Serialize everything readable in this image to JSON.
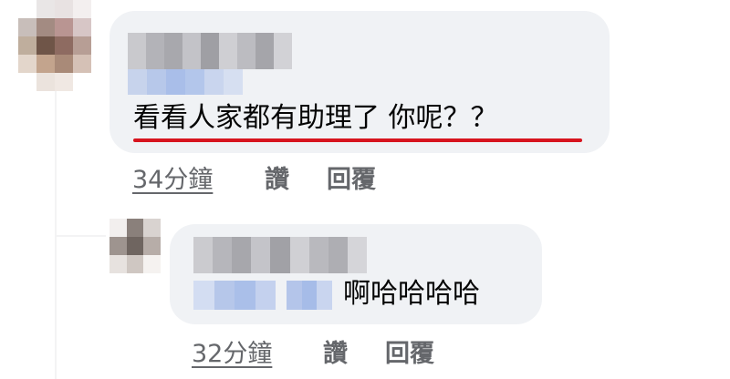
{
  "main_comment": {
    "text": "看看人家都有助理了 你呢？？",
    "time": "34分鐘",
    "like_label": "讚",
    "reply_label": "回覆",
    "highlight_color": "#d7141e"
  },
  "reply_comment": {
    "text": "啊哈哈哈哈",
    "time": "32分鐘",
    "like_label": "讚",
    "reply_label": "回覆"
  },
  "colors": {
    "bubble": "#f0f2f5",
    "text": "#050505",
    "secondary": "#65676b"
  }
}
